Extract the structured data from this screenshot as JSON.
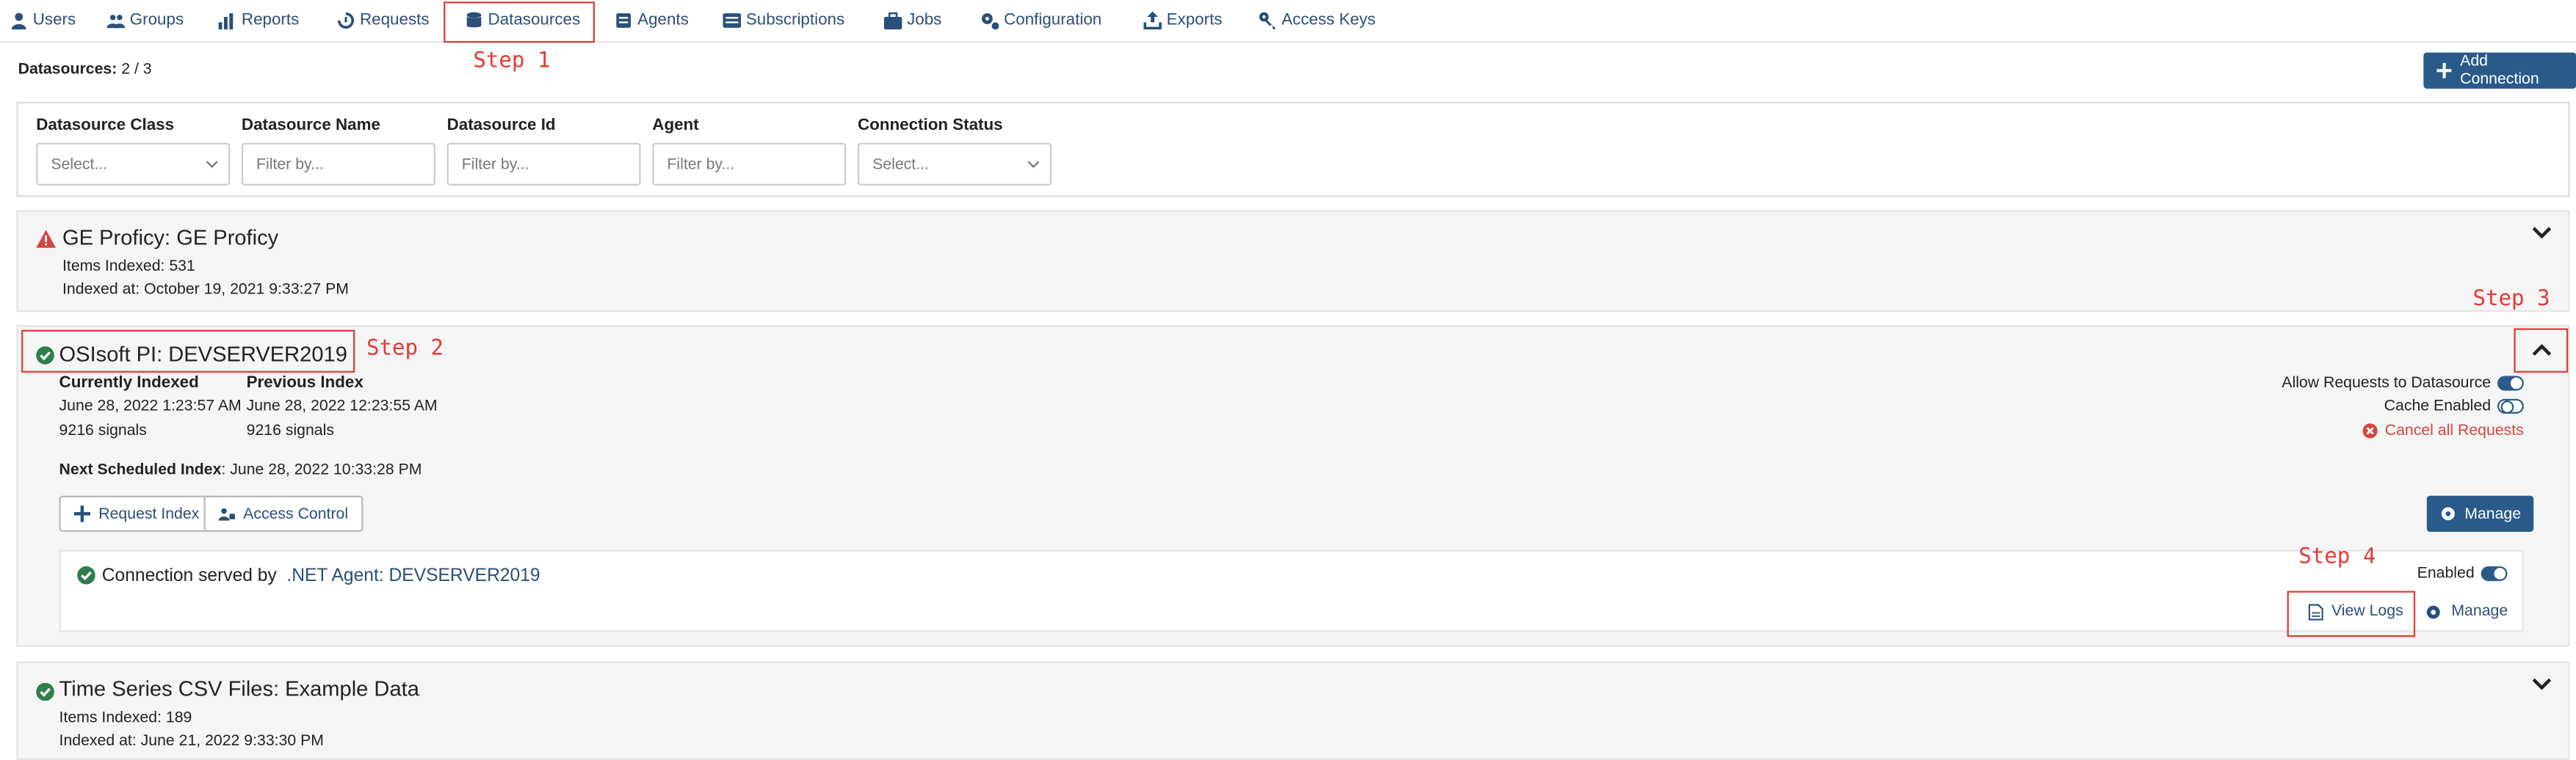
{
  "nav": {
    "items": [
      {
        "label": "Users",
        "icon": "user-icon"
      },
      {
        "label": "Groups",
        "icon": "groups-icon"
      },
      {
        "label": "Reports",
        "icon": "reports-icon"
      },
      {
        "label": "Requests",
        "icon": "requests-icon"
      },
      {
        "label": "Datasources",
        "icon": "database-icon"
      },
      {
        "label": "Agents",
        "icon": "agents-icon"
      },
      {
        "label": "Subscriptions",
        "icon": "subscriptions-icon"
      },
      {
        "label": "Jobs",
        "icon": "jobs-icon"
      },
      {
        "label": "Configuration",
        "icon": "gears-icon"
      },
      {
        "label": "Exports",
        "icon": "export-icon"
      },
      {
        "label": "Access Keys",
        "icon": "key-icon"
      }
    ]
  },
  "steps": {
    "s1": "Step 1",
    "s2": "Step 2",
    "s3": "Step 3",
    "s4": "Step 4"
  },
  "summary": {
    "label": "Datasources:",
    "value": "2 / 3"
  },
  "add_connection": "Add Connection",
  "filters": {
    "class_label": "Datasource Class",
    "class_value": "Select...",
    "name_label": "Datasource Name",
    "name_placeholder": "Filter by...",
    "id_label": "Datasource Id",
    "id_placeholder": "Filter by...",
    "agent_label": "Agent",
    "agent_placeholder": "Filter by...",
    "status_label": "Connection Status",
    "status_value": "Select..."
  },
  "cards": {
    "ge": {
      "title": "GE Proficy: GE Proficy",
      "items_indexed": "Items Indexed: 531",
      "indexed_at": "Indexed at: October 19, 2021 9:33:27 PM",
      "status": "warning"
    },
    "osi": {
      "title": "OSIsoft PI: DEVSERVER2019",
      "current_label": "Currently Indexed",
      "current_date": "June 28, 2022 1:23:57 AM",
      "current_signals": "9216 signals",
      "prev_label": "Previous Index",
      "prev_date": "June 28, 2022 12:23:55 AM",
      "prev_signals": "9216 signals",
      "next_label": "Next Scheduled Index",
      "next_value": ": June 28, 2022 10:33:28 PM",
      "allow_requests": "Allow Requests to Datasource",
      "cache_enabled": "Cache Enabled",
      "cancel_all": "Cancel all Requests",
      "request_index": "Request Index",
      "access_control": "Access Control",
      "manage": "Manage",
      "connection_prefix": "Connection served by",
      "connection_agent": ".NET Agent: DEVSERVER2019",
      "enabled": "Enabled",
      "view_logs": "View Logs",
      "conn_manage": "Manage"
    },
    "csv": {
      "title": "Time Series CSV Files: Example Data",
      "items_indexed": "Items Indexed: 189",
      "indexed_at": "Indexed at: June 21, 2022 9:33:30 PM"
    }
  },
  "colors": {
    "primary": "#2a5a8a",
    "link": "#2a4f7a",
    "ok": "#2e7d4f",
    "warn": "#d64541",
    "annotation": "#e53935"
  }
}
